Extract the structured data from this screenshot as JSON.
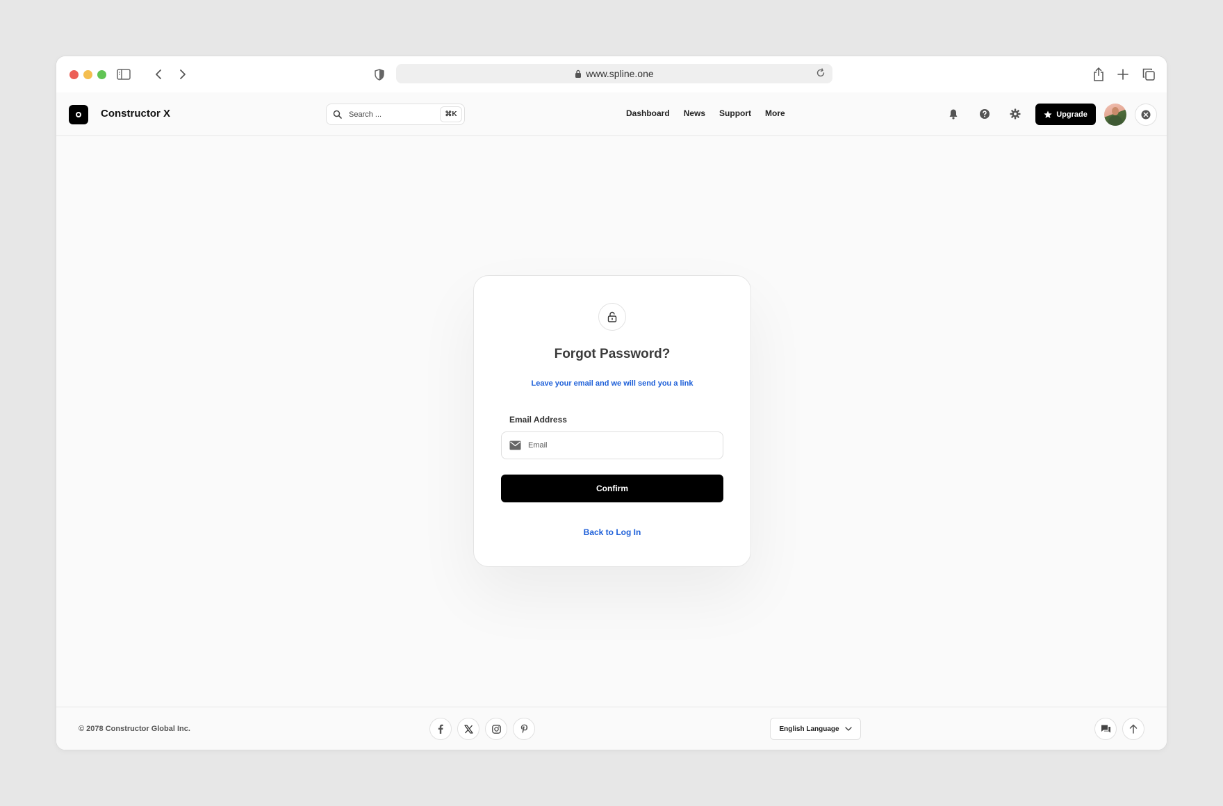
{
  "browser": {
    "url": "www.spline.one",
    "traffic_lights": {
      "close": "#ec5f57",
      "minimize": "#f4be4f",
      "maximize": "#61c454"
    }
  },
  "header": {
    "brand": "Constructor X",
    "search_placeholder": "Search ...",
    "search_shortcut": "⌘K",
    "nav": [
      "Dashboard",
      "News",
      "Support",
      "More"
    ],
    "upgrade_label": "Upgrade"
  },
  "card": {
    "title": "Forgot Password?",
    "subtitle": "Leave your email and we will send you a link",
    "email_label": "Email Address",
    "email_placeholder": "Email",
    "email_value": "",
    "confirm_label": "Confirm",
    "back_label": "Back to Log In"
  },
  "footer": {
    "copyright": "© 2078 Constructor Global Inc.",
    "social": [
      "facebook-icon",
      "x-icon",
      "instagram-icon",
      "pinterest-icon"
    ],
    "language": "English Language"
  },
  "colors": {
    "accent_blue": "#1d5fd8",
    "primary_button": "#000000",
    "background": "#fafafa"
  }
}
